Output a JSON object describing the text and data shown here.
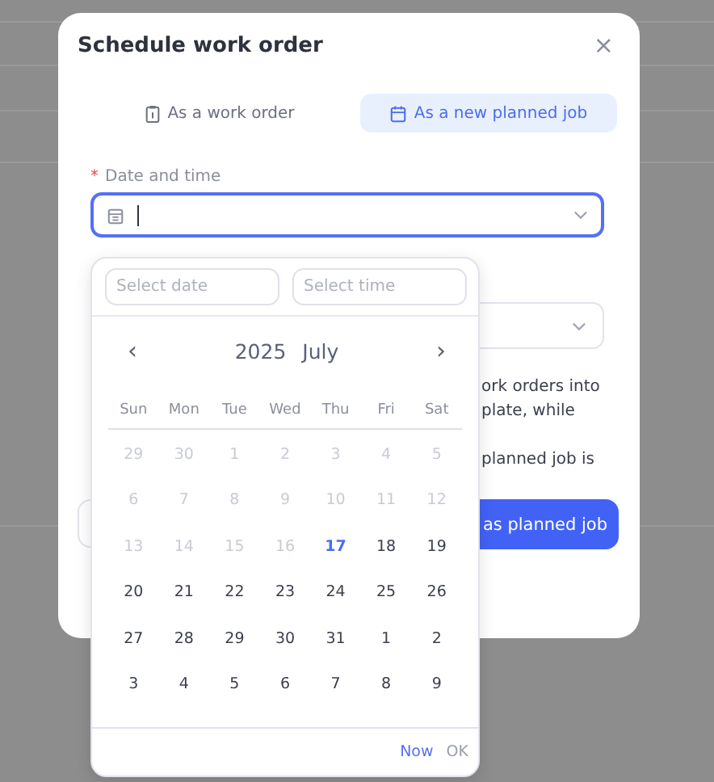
{
  "dialog": {
    "title": "Schedule work order",
    "close": "×"
  },
  "tabs": [
    {
      "label": "As a work order",
      "selected": false
    },
    {
      "label": "As a new planned job",
      "selected": true
    }
  ],
  "date_field": {
    "required_mark": "*",
    "label": "Date and time",
    "focused": true
  },
  "behind": {
    "lines": [
      "ork orders into",
      "plate, while",
      "planned job is"
    ],
    "primary_button": "as planned job"
  },
  "picker": {
    "date_placeholder": "Select date",
    "time_placeholder": "Select time",
    "prev": "‹",
    "next": "›",
    "year": "2025",
    "month": "July",
    "weekdays": [
      "Sun",
      "Mon",
      "Tue",
      "Wed",
      "Thu",
      "Fri",
      "Sat"
    ],
    "days": [
      {
        "label": "29",
        "kind": "disabled"
      },
      {
        "label": "30",
        "kind": "disabled"
      },
      {
        "label": "1",
        "kind": "disabled"
      },
      {
        "label": "2",
        "kind": "disabled"
      },
      {
        "label": "3",
        "kind": "disabled"
      },
      {
        "label": "4",
        "kind": "disabled"
      },
      {
        "label": "5",
        "kind": "disabled"
      },
      {
        "label": "6",
        "kind": "disabled"
      },
      {
        "label": "7",
        "kind": "disabled"
      },
      {
        "label": "8",
        "kind": "disabled"
      },
      {
        "label": "9",
        "kind": "disabled"
      },
      {
        "label": "10",
        "kind": "disabled"
      },
      {
        "label": "11",
        "kind": "disabled"
      },
      {
        "label": "12",
        "kind": "disabled"
      },
      {
        "label": "13",
        "kind": "disabled"
      },
      {
        "label": "14",
        "kind": "disabled"
      },
      {
        "label": "15",
        "kind": "disabled"
      },
      {
        "label": "16",
        "kind": "disabled"
      },
      {
        "label": "17",
        "kind": "today"
      },
      {
        "label": "18",
        "kind": "normal"
      },
      {
        "label": "19",
        "kind": "normal"
      },
      {
        "label": "20",
        "kind": "normal"
      },
      {
        "label": "21",
        "kind": "normal"
      },
      {
        "label": "22",
        "kind": "normal"
      },
      {
        "label": "23",
        "kind": "normal"
      },
      {
        "label": "24",
        "kind": "normal"
      },
      {
        "label": "25",
        "kind": "normal"
      },
      {
        "label": "26",
        "kind": "normal"
      },
      {
        "label": "27",
        "kind": "normal"
      },
      {
        "label": "28",
        "kind": "normal"
      },
      {
        "label": "29",
        "kind": "normal"
      },
      {
        "label": "30",
        "kind": "normal"
      },
      {
        "label": "31",
        "kind": "normal"
      },
      {
        "label": "1",
        "kind": "normal"
      },
      {
        "label": "2",
        "kind": "normal"
      },
      {
        "label": "3",
        "kind": "normal"
      },
      {
        "label": "4",
        "kind": "normal"
      },
      {
        "label": "5",
        "kind": "normal"
      },
      {
        "label": "6",
        "kind": "normal"
      },
      {
        "label": "7",
        "kind": "normal"
      },
      {
        "label": "8",
        "kind": "normal"
      },
      {
        "label": "9",
        "kind": "normal"
      }
    ],
    "now": "Now",
    "ok": "OK"
  }
}
